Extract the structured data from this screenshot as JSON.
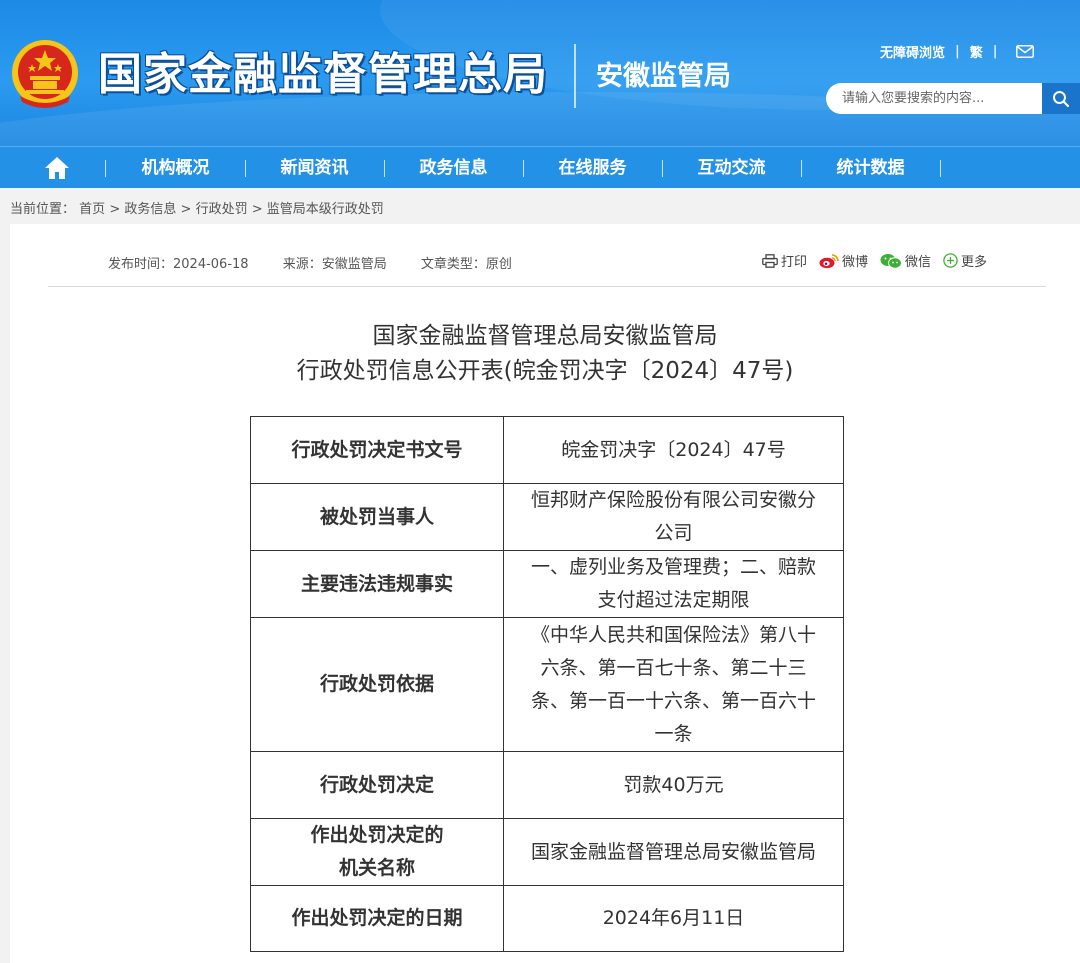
{
  "header": {
    "site_title": "国家金融监督管理总局",
    "sub_title": "安徽监管局",
    "accessibility": "无障碍浏览",
    "traditional": "繁",
    "search_placeholder": "请输入您要搜索的内容..."
  },
  "nav": {
    "items": [
      "机构概况",
      "新闻资讯",
      "政务信息",
      "在线服务",
      "互动交流",
      "统计数据"
    ]
  },
  "breadcrumb": {
    "prefix": "当前位置：",
    "items": [
      "首页",
      "政务信息",
      "行政处罚",
      "监管局本级行政处罚"
    ],
    "separator": ">"
  },
  "article": {
    "publish_time": "发布时间：2024-06-18",
    "source": "来源：安徽监管局",
    "type": "文章类型：原创",
    "share": {
      "print": "打印",
      "weibo": "微博",
      "wechat": "微信",
      "more": "更多"
    },
    "title_line1": "国家金融监督管理总局安徽监管局",
    "title_line2": "行政处罚信息公开表(皖金罚决字〔2024〕47号)",
    "table": [
      {
        "key": "行政处罚决定书文号",
        "value_lines": [
          "皖金罚决字〔2024〕47号"
        ]
      },
      {
        "key": "被处罚当事人",
        "value_lines": [
          "恒邦财产保险股份有限公司安徽分",
          "公司"
        ]
      },
      {
        "key": "主要违法违规事实",
        "value_lines": [
          "一、虚列业务及管理费；二、赔款",
          "支付超过法定期限"
        ]
      },
      {
        "key": "行政处罚依据",
        "value_lines": [
          "《中华人民共和国保险法》第八十",
          "六条、第一百七十条、第二十三",
          "条、第一百一十六条、第一百六十",
          "一条"
        ]
      },
      {
        "key": "行政处罚决定",
        "value_lines": [
          "罚款40万元"
        ]
      },
      {
        "key_lines": [
          "作出处罚决定的",
          "机关名称"
        ],
        "value_lines": [
          "国家金融监督管理总局安徽监管局"
        ]
      },
      {
        "key": "作出处罚决定的日期",
        "value_lines": [
          "2024年6月11日"
        ]
      }
    ]
  },
  "colors": {
    "header_blue": "#2391e6",
    "search_button": "#1a74c9",
    "emblem_red": "#d7261b",
    "emblem_gold": "#f5c518"
  }
}
